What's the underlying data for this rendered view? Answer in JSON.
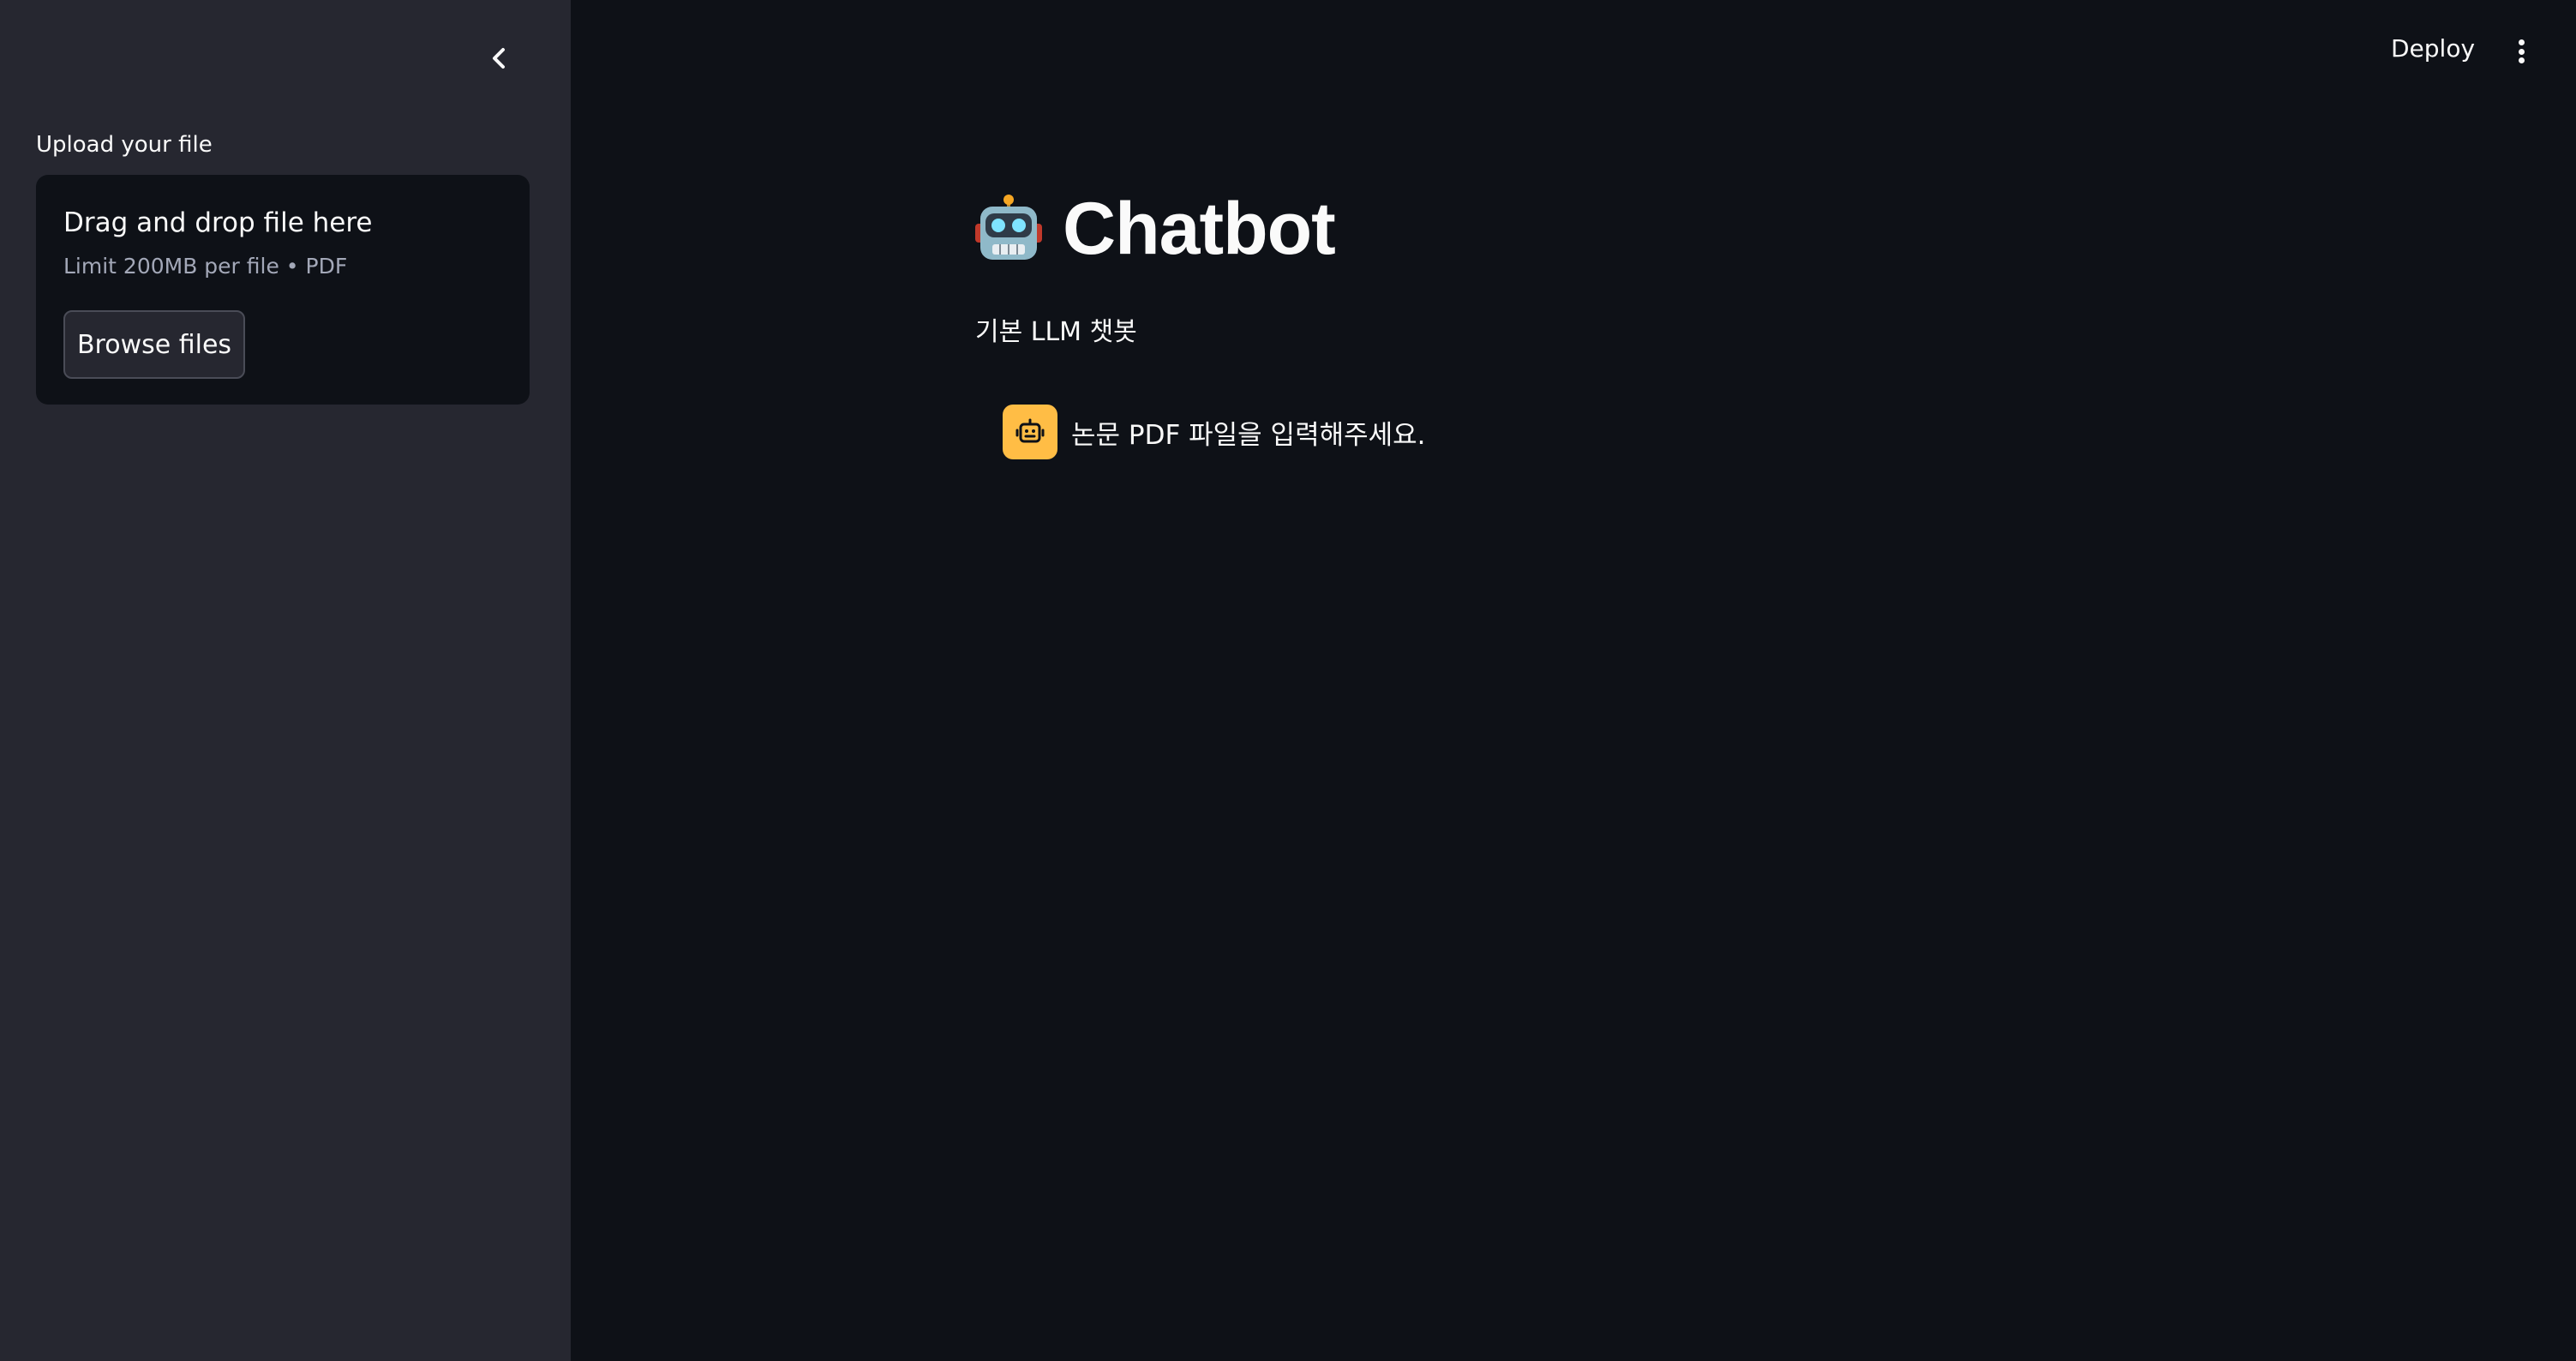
{
  "sidebar": {
    "upload_label": "Upload your file",
    "dropzone": {
      "title": "Drag and drop file here",
      "subtitle": "Limit 200MB per file • PDF",
      "browse_label": "Browse files"
    }
  },
  "header": {
    "deploy_label": "Deploy"
  },
  "main": {
    "title": "Chatbot",
    "subtitle": "기본 LLM 챗봇",
    "messages": [
      {
        "role": "assistant",
        "text": "논문 PDF 파일을 입력해주세요."
      }
    ]
  },
  "colors": {
    "background": "#0e1117",
    "sidebar": "#262730",
    "avatar": "#ffbd45",
    "text": "#fafafa"
  },
  "icons": {
    "collapse": "chevron-left-icon",
    "menu": "kebab-menu-icon",
    "title": "robot-emoji-icon",
    "avatar": "robot-face-icon"
  }
}
